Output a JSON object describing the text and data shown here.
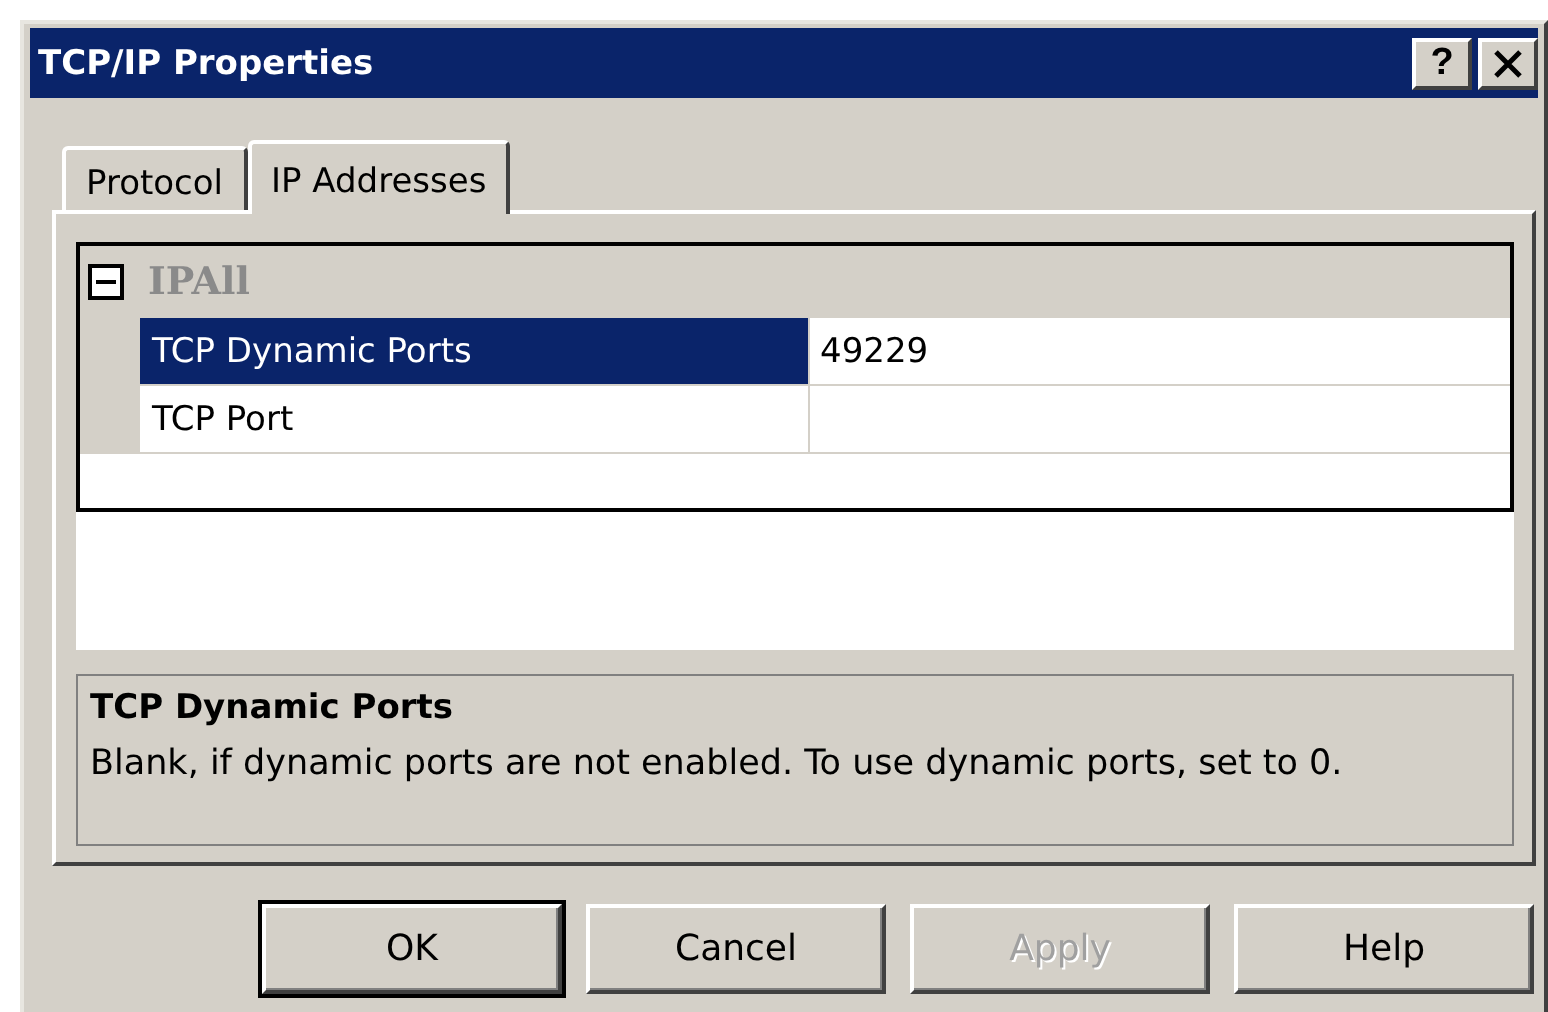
{
  "window": {
    "title": "TCP/IP Properties",
    "help_button": "?"
  },
  "tabs": [
    {
      "label": "Protocol",
      "selected": false
    },
    {
      "label": "IP Addresses",
      "selected": true
    }
  ],
  "property_grid": {
    "group": {
      "label": "IPAll",
      "expanded": true,
      "disabled": true
    },
    "rows": [
      {
        "name": "TCP Dynamic Ports",
        "value": "49229",
        "selected": true
      },
      {
        "name": "TCP Port",
        "selected": false
      }
    ]
  },
  "description": {
    "title": "TCP Dynamic Ports",
    "text": "Blank, if dynamic ports are not enabled. To use dynamic ports, set to 0."
  },
  "buttons": [
    {
      "label": "OK",
      "default": true,
      "disabled": false
    },
    {
      "label": "Cancel",
      "default": false,
      "disabled": false
    },
    {
      "label": "Apply",
      "default": false,
      "disabled": true
    },
    {
      "label": "Help",
      "default": false,
      "disabled": false
    }
  ]
}
